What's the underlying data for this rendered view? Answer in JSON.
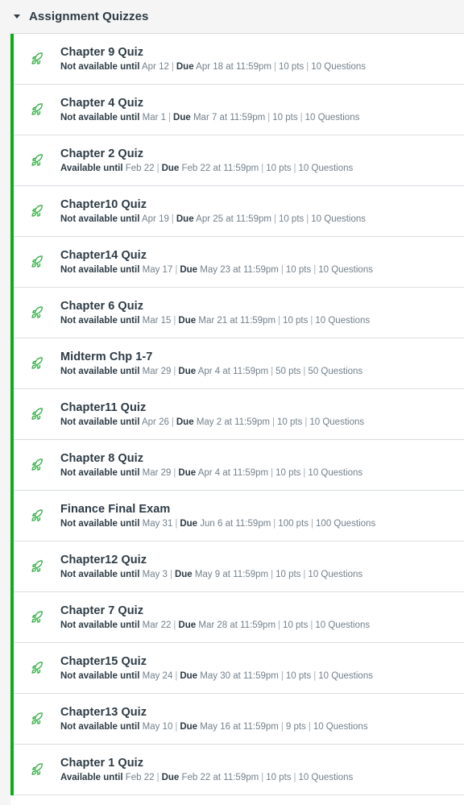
{
  "header": {
    "title": "Assignment Quizzes",
    "toggle_icon": "caret-down-icon"
  },
  "colors": {
    "accent_green": "#0bad18",
    "title_text": "#2d3b45",
    "meta_text": "#73818c",
    "header_bg": "#f5f5f5",
    "divider": "#d9dde1"
  },
  "row_icon": "rocket-icon",
  "separator": "|",
  "quizzes": [
    {
      "title": "Chapter 9 Quiz",
      "availability_label": "Not available until",
      "availability_value": "Apr 12",
      "due_label": "Due",
      "due_value": "Apr 18 at 11:59pm",
      "points": "10 pts",
      "questions": "10 Questions"
    },
    {
      "title": "Chapter 4 Quiz",
      "availability_label": "Not available until",
      "availability_value": "Mar 1",
      "due_label": "Due",
      "due_value": "Mar 7 at 11:59pm",
      "points": "10 pts",
      "questions": "10 Questions"
    },
    {
      "title": "Chapter 2 Quiz",
      "availability_label": "Available until",
      "availability_value": "Feb 22",
      "due_label": "Due",
      "due_value": "Feb 22 at 11:59pm",
      "points": "10 pts",
      "questions": "10 Questions"
    },
    {
      "title": "Chapter10 Quiz",
      "availability_label": "Not available until",
      "availability_value": "Apr 19",
      "due_label": "Due",
      "due_value": "Apr 25 at 11:59pm",
      "points": "10 pts",
      "questions": "10 Questions"
    },
    {
      "title": "Chapter14 Quiz",
      "availability_label": "Not available until",
      "availability_value": "May 17",
      "due_label": "Due",
      "due_value": "May 23 at 11:59pm",
      "points": "10 pts",
      "questions": "10 Questions"
    },
    {
      "title": "Chapter 6 Quiz",
      "availability_label": "Not available until",
      "availability_value": "Mar 15",
      "due_label": "Due",
      "due_value": "Mar 21 at 11:59pm",
      "points": "10 pts",
      "questions": "10 Questions"
    },
    {
      "title": "Midterm Chp 1-7",
      "availability_label": "Not available until",
      "availability_value": "Mar 29",
      "due_label": "Due",
      "due_value": "Apr 4 at 11:59pm",
      "points": "50 pts",
      "questions": "50 Questions"
    },
    {
      "title": "Chapter11 Quiz",
      "availability_label": "Not available until",
      "availability_value": "Apr 26",
      "due_label": "Due",
      "due_value": "May 2 at 11:59pm",
      "points": "10 pts",
      "questions": "10 Questions"
    },
    {
      "title": "Chapter 8 Quiz",
      "availability_label": "Not available until",
      "availability_value": "Mar 29",
      "due_label": "Due",
      "due_value": "Apr 4 at 11:59pm",
      "points": "10 pts",
      "questions": "10 Questions"
    },
    {
      "title": "Finance Final Exam",
      "availability_label": "Not available until",
      "availability_value": "May 31",
      "due_label": "Due",
      "due_value": "Jun 6 at 11:59pm",
      "points": "100 pts",
      "questions": "100 Questions"
    },
    {
      "title": "Chapter12 Quiz",
      "availability_label": "Not available until",
      "availability_value": "May 3",
      "due_label": "Due",
      "due_value": "May 9 at 11:59pm",
      "points": "10 pts",
      "questions": "10 Questions"
    },
    {
      "title": "Chapter 7 Quiz",
      "availability_label": "Not available until",
      "availability_value": "Mar 22",
      "due_label": "Due",
      "due_value": "Mar 28 at 11:59pm",
      "points": "10 pts",
      "questions": "10 Questions"
    },
    {
      "title": "Chapter15 Quiz",
      "availability_label": "Not available until",
      "availability_value": "May 24",
      "due_label": "Due",
      "due_value": "May 30 at 11:59pm",
      "points": "10 pts",
      "questions": "10 Questions"
    },
    {
      "title": "Chapter13 Quiz",
      "availability_label": "Not available until",
      "availability_value": "May 10",
      "due_label": "Due",
      "due_value": "May 16 at 11:59pm",
      "points": "9 pts",
      "questions": "10 Questions"
    },
    {
      "title": "Chapter 1 Quiz",
      "availability_label": "Available until",
      "availability_value": "Feb 22",
      "due_label": "Due",
      "due_value": "Feb 22 at 11:59pm",
      "points": "10 pts",
      "questions": "10 Questions"
    }
  ]
}
